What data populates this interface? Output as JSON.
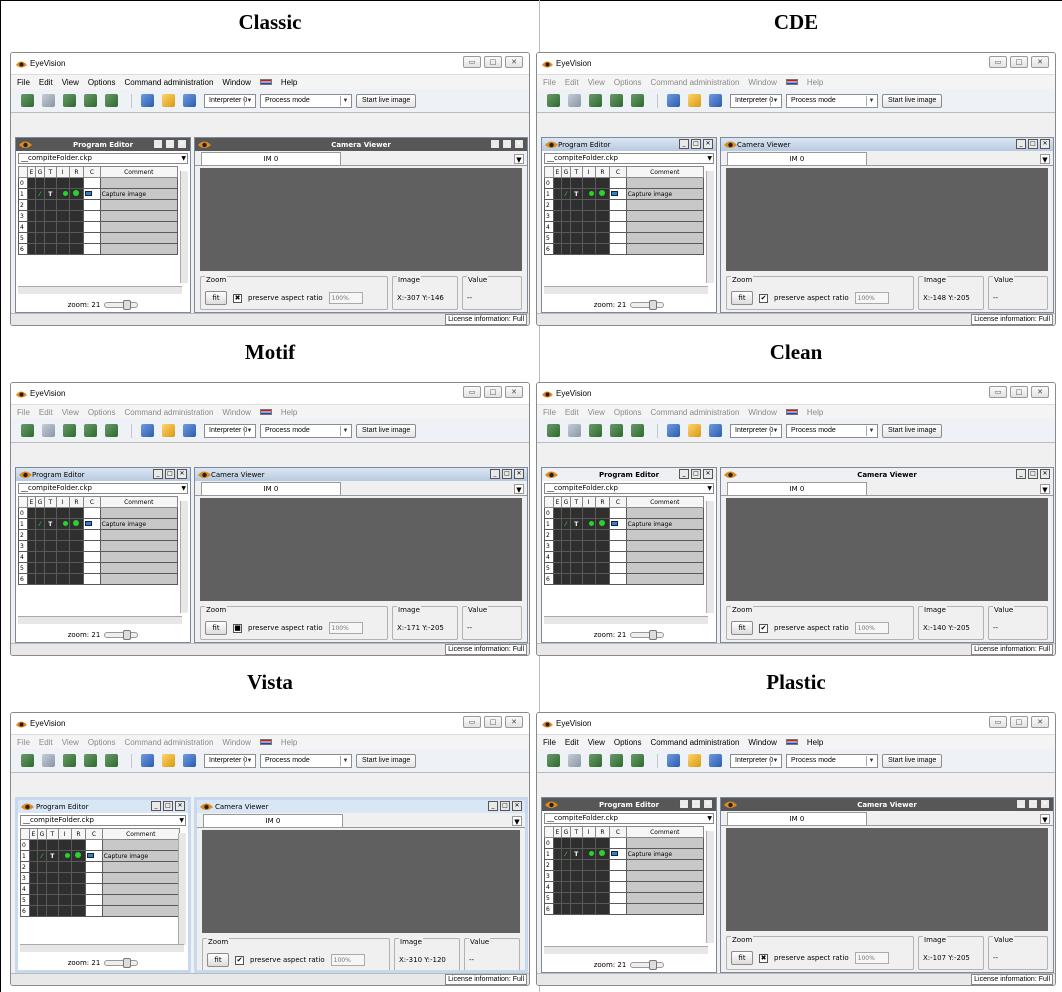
{
  "panels": [
    {
      "style_title": "Classic",
      "variant": "classic",
      "window_title": "EyeVision",
      "coords": "X:-307  Y:-146",
      "aspect_mark": "✖"
    },
    {
      "style_title": "CDE",
      "variant": "cde",
      "window_title": "EyeVision",
      "coords": "X:-148  Y:-205",
      "aspect_mark": "✔"
    },
    {
      "style_title": "Motif",
      "variant": "motif",
      "window_title": "EyeVision",
      "coords": "X:-171  Y:-205",
      "aspect_mark": "■"
    },
    {
      "style_title": "Clean",
      "variant": "clean",
      "window_title": "EyeVision",
      "coords": "X:-140  Y:-205",
      "aspect_mark": "✔"
    },
    {
      "style_title": "Vista",
      "variant": "vista",
      "window_title": "EyeVision",
      "coords": "X:-310  Y:-120",
      "aspect_mark": "✔"
    },
    {
      "style_title": "Plastic",
      "variant": "plastic",
      "window_title": "EyeVision",
      "coords": "X:-107  Y:-205",
      "aspect_mark": "✖"
    }
  ],
  "menu": [
    "File",
    "Edit",
    "View",
    "Options",
    "Command administration",
    "Window",
    "Help"
  ],
  "toolbar": {
    "interpreter": "Interpreter 0",
    "mode": "Process mode",
    "start_live": "Start live image"
  },
  "program_editor": {
    "title": "Program Editor",
    "file": "__compiteFolder.ckp",
    "columns": [
      "E",
      "G",
      "T",
      "I",
      "R",
      "C",
      "Comment"
    ],
    "rows": [
      "0",
      "1",
      "2",
      "3",
      "4",
      "5",
      "6"
    ],
    "row1_comment": "Capture image",
    "zoom": "zoom: 21"
  },
  "camera_viewer": {
    "title": "Camera Viewer",
    "tab": "IM 0",
    "zoom_label": "Zoom",
    "fit": "fit",
    "preserve": "preserve aspect ratio",
    "percent": "100%",
    "image_label": "Image",
    "value_label": "Value",
    "value": "--"
  },
  "status": {
    "license": "License information: Full"
  },
  "colors": {
    "viewer_bg": "#606060",
    "grid_dark": "#2f2f2f",
    "grid_light": "#c8c8c8",
    "title_dark": "#575757"
  }
}
